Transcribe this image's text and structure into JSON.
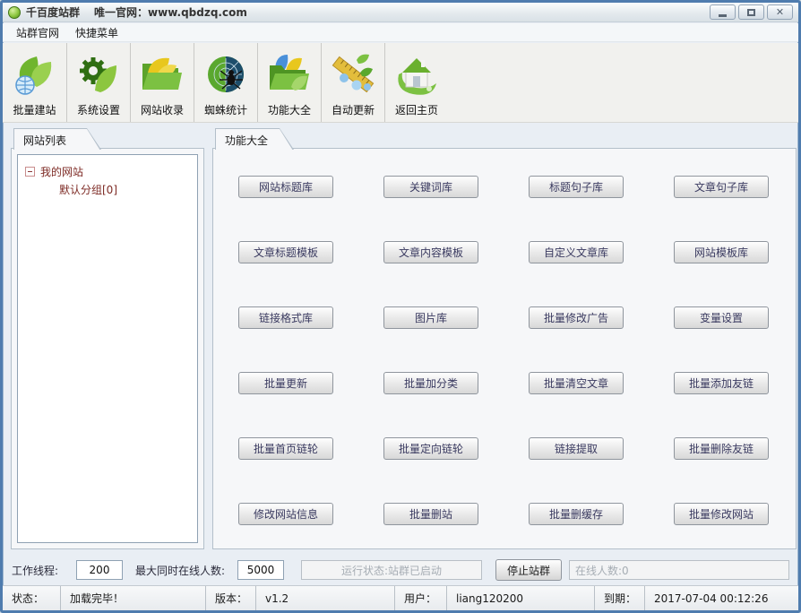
{
  "window": {
    "app_name": "千百度站群",
    "subtitle": "唯一官网：www.qbdzq.com"
  },
  "menu": {
    "items": [
      "站群官网",
      "快捷菜单"
    ]
  },
  "toolbar": {
    "items": [
      {
        "label": "批量建站",
        "icon": "leaves-globe-icon"
      },
      {
        "label": "系统设置",
        "icon": "gear-leaf-icon"
      },
      {
        "label": "网站收录",
        "icon": "folder-yellow-leaves-icon"
      },
      {
        "label": "蜘蛛统计",
        "icon": "spider-web-icon"
      },
      {
        "label": "功能大全",
        "icon": "folder-leaves-icon"
      },
      {
        "label": "自动更新",
        "icon": "ruler-branch-icon"
      },
      {
        "label": "返回主页",
        "icon": "home-leaf-icon"
      }
    ]
  },
  "sidebar": {
    "tab": "网站列表",
    "tree": {
      "root": "我的网站",
      "children": [
        "默认分组[0]"
      ]
    }
  },
  "main": {
    "tab": "功能大全",
    "buttons": [
      "网站标题库",
      "关键词库",
      "标题句子库",
      "文章句子库",
      "文章标题模板",
      "文章内容模板",
      "自定义文章库",
      "网站模板库",
      "链接格式库",
      "图片库",
      "批量修改广告",
      "变量设置",
      "批量更新",
      "批量加分类",
      "批量清空文章",
      "批量添加友链",
      "批量首页链轮",
      "批量定向链轮",
      "链接提取",
      "批量删除友链",
      "修改网站信息",
      "批量删站",
      "批量删缓存",
      "批量修改网站"
    ]
  },
  "controls_bar": {
    "thread_label": "工作线程:",
    "thread_value": "200",
    "max_online_label": "最大同时在线人数:",
    "max_online_value": "5000",
    "run_status": "运行状态:站群已启动",
    "stop_button": "停止站群",
    "online_count": "在线人数:0"
  },
  "status_bar": {
    "status_label": "状态：",
    "status_value": "加载完毕！",
    "version_label": "版本：",
    "version_value": "v1.2",
    "user_label": "用户：",
    "user_value": "liang120200",
    "expiry_label": "到期：",
    "expiry_value": "2017-07-04 00:12:26"
  }
}
